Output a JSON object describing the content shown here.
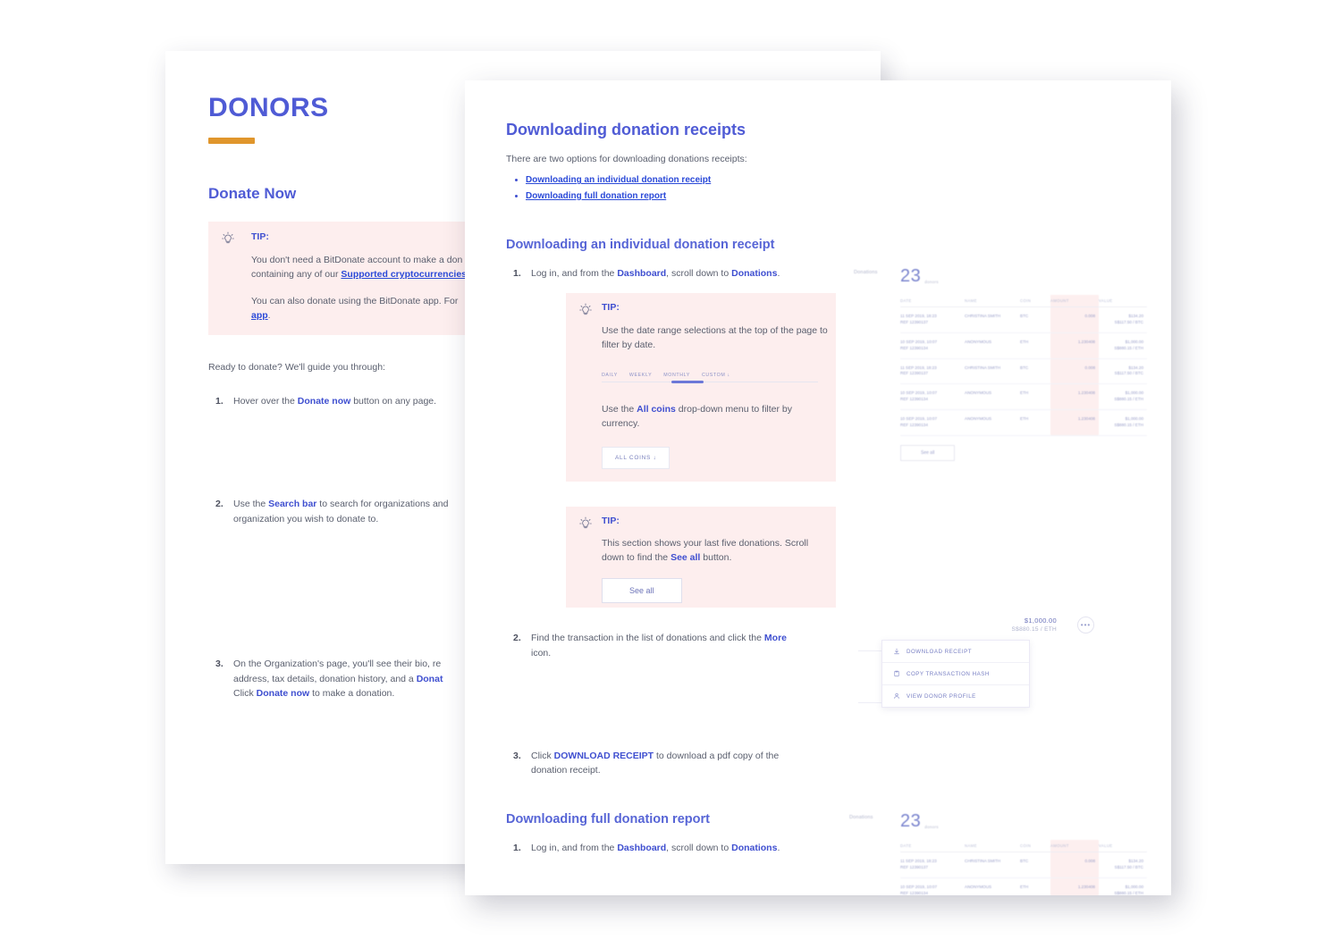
{
  "back_page": {
    "title": "DONORS",
    "section_heading": "Donate Now",
    "tip": {
      "icon": "lightbulb-icon",
      "label": "TIP:",
      "paragraph1_a": "You don't need a BitDonate account to make a don",
      "paragraph1_b": "containing any of our ",
      "paragraph1_link": "Supported cryptocurrencies",
      "paragraph2_a": "You can also donate using the BitDonate app. For",
      "paragraph2_link": "app",
      "paragraph2_end": "."
    },
    "intro": "Ready to donate? We'll guide you through:",
    "steps": [
      {
        "num": "1.",
        "a": "Hover over the ",
        "link": "Donate now",
        "b": " button on any page."
      },
      {
        "num": "2.",
        "a": "Use the ",
        "link": "Search bar",
        "b": " to search for organizations and",
        "c": "organization you wish to donate to."
      },
      {
        "num": "3.",
        "a": "On the Organization's page, you'll see their bio, re",
        "b": "address, tax details, donation history, and a ",
        "link1": "Donat",
        "c": "Click ",
        "link2": "Donate now",
        "d": " to make a donation."
      }
    ]
  },
  "front_page": {
    "title": "Downloading donation receipts",
    "intro": "There are two options for downloading donations receipts:",
    "toc": [
      "Downloading an individual donation receipt",
      "Downloading full donation report"
    ],
    "section1": {
      "heading": "Downloading an individual donation receipt",
      "step1": {
        "num": "1.",
        "a": "Log in, and from the ",
        "link1": "Dashboard",
        "b": ", scroll down to ",
        "link2": "Donations",
        "c": "."
      },
      "tip1": {
        "icon": "lightbulb-icon",
        "label": "TIP:",
        "text1": "Use the date range selections at the top of the page to filter by date.",
        "tabs": [
          "DAILY",
          "WEEKLY",
          "MONTHLY",
          "CUSTOM ↓"
        ],
        "active_tab": "MONTHLY",
        "text2_a": "Use the ",
        "text2_link": "All coins",
        "text2_b": " drop-down menu to filter by currency.",
        "dropdown_label": "ALL COINS ↓"
      },
      "tip2": {
        "icon": "lightbulb-icon",
        "label": "TIP:",
        "text_a": "This section shows your last five donations. Scroll down to find the ",
        "text_link": "See all",
        "text_b": " button.",
        "button_label": "See all"
      },
      "step2": {
        "num": "2.",
        "a": "Find the transaction in the list of donations and click the ",
        "link": "More",
        "b": " icon."
      },
      "step3": {
        "num": "3.",
        "a": "Click ",
        "link": "DOWNLOAD RECEIPT",
        "b": " to download a pdf copy of the donation receipt."
      }
    },
    "section2": {
      "heading": "Downloading full donation report",
      "step1": {
        "num": "1.",
        "a": "Log in, and from the ",
        "link1": "Dashboard",
        "b": ", scroll down to ",
        "link2": "Donations",
        "c": "."
      }
    }
  },
  "app_screenshot_top": {
    "section_label": "Donations",
    "count": "23",
    "count_unit": "donors",
    "columns": [
      "DATE",
      "NAME",
      "COIN",
      "AMOUNT",
      "VALUE"
    ],
    "rows": [
      {
        "date": "11 SEP 2019, 18:23",
        "date_sub": "REF 12390137",
        "name": "CHRISTINA SMITH",
        "coin": "BTC",
        "amount": "0.008",
        "value": "$134.20",
        "value_sub": "S$117.50 / BTC"
      },
      {
        "date": "10 SEP 2019, 10:07",
        "date_sub": "REF 12390134",
        "name": "ANONYMOUS",
        "coin": "ETH",
        "amount": "1.230408",
        "value": "$1,000.00",
        "value_sub": "S$880.15 / ETH"
      },
      {
        "date": "11 SEP 2019, 18:23",
        "date_sub": "REF 12390137",
        "name": "CHRISTINA SMITH",
        "coin": "BTC",
        "amount": "0.008",
        "value": "$134.20",
        "value_sub": "S$117.50 / BTC"
      },
      {
        "date": "10 SEP 2019, 10:07",
        "date_sub": "REF 12390134",
        "name": "ANONYMOUS",
        "coin": "ETH",
        "amount": "1.230408",
        "value": "$1,000.00",
        "value_sub": "S$880.15 / ETH"
      },
      {
        "date": "10 SEP 2019, 10:07",
        "date_sub": "REF 12390134",
        "name": "ANONYMOUS",
        "coin": "ETH",
        "amount": "1.230408",
        "value": "$1,000.00",
        "value_sub": "S$880.15 / ETH"
      }
    ],
    "see_all_label": "See all"
  },
  "app_screenshot_bottom": {
    "section_label": "Donations",
    "count": "23",
    "count_unit": "donors",
    "columns": [
      "DATE",
      "NAME",
      "COIN",
      "AMOUNT",
      "VALUE"
    ],
    "rows": [
      {
        "date": "11 SEP 2019, 18:23",
        "date_sub": "REF 12390137",
        "name": "CHRISTINA SMITH",
        "coin": "BTC",
        "amount": "0.008",
        "value": "$134.20",
        "value_sub": "S$117.50 / BTC"
      },
      {
        "date": "10 SEP 2019, 10:07",
        "date_sub": "REF 12390134",
        "name": "ANONYMOUS",
        "coin": "ETH",
        "amount": "1.230408",
        "value": "$1,000.00",
        "value_sub": "S$880.15 / ETH"
      }
    ]
  },
  "more_menu_screenshot": {
    "amount_primary": "$1,000.00",
    "amount_secondary": "S$880.15 / ETH",
    "more_icon": "•••",
    "items": [
      {
        "icon": "download-icon",
        "label": "DOWNLOAD RECEIPT"
      },
      {
        "icon": "clipboard-icon",
        "label": "COPY TRANSACTION HASH"
      },
      {
        "icon": "person-icon",
        "label": "VIEW DONOR PROFILE"
      }
    ]
  },
  "colors": {
    "accent_purple": "#4f5bd5",
    "link_blue": "#2b4ad8",
    "tip_bg": "#fdeeee",
    "orange_rule": "#e0962c",
    "body_gray": "#5a5f6e"
  }
}
